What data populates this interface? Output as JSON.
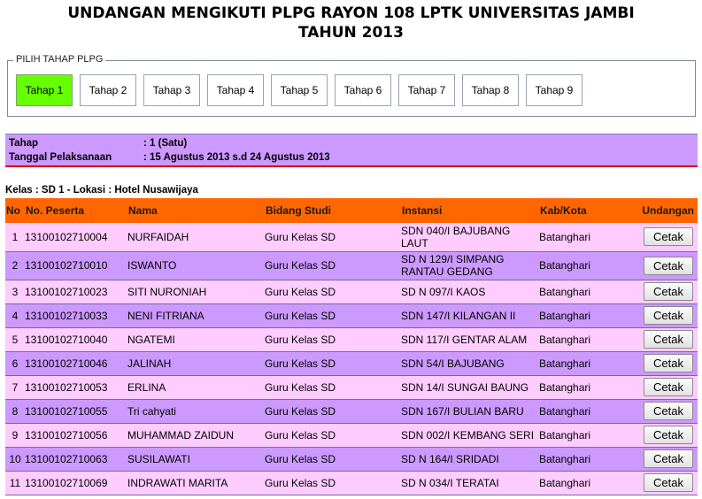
{
  "page": {
    "title_line1": "UNDANGAN MENGIKUTI PLPG RAYON 108 LPTK UNIVERSITAS JAMBI",
    "title_line2": "TAHUN 2013"
  },
  "tahap_selector": {
    "legend": "PILIH TAHAP PLPG",
    "tabs": [
      "Tahap 1",
      "Tahap 2",
      "Tahap 3",
      "Tahap 4",
      "Tahap 5",
      "Tahap 6",
      "Tahap 7",
      "Tahap 8",
      "Tahap 9"
    ],
    "active_tab": "Tahap 1",
    "active_color": "#66ff00"
  },
  "info": {
    "tahap_label": "Tahap",
    "tahap_value": ": 1 (Satu)",
    "tanggal_label": "Tanggal Pelaksanaan",
    "tanggal_value": ": 15 Agustus 2013 s.d 24 Agustus 2013",
    "background_color": "#cc99ff",
    "border_color": "#d40000"
  },
  "kelas": "Kelas : SD 1 - Lokasi : Hotel Nusawijaya",
  "table": {
    "header_color": "#ff6600",
    "odd_row_color": "#ffccff",
    "even_row_color": "#cc99ff",
    "columns": {
      "no": "No",
      "no_peserta": "No. Peserta",
      "nama": "Nama",
      "bidang_studi": "Bidang Studi",
      "instansi": "Instansi",
      "kab_kota": "Kab/Kota",
      "undangan": "Undangan"
    },
    "button_label": "Cetak",
    "rows": [
      {
        "no": "1",
        "peserta": "13100102710004",
        "nama": "NURFAIDAH",
        "bidang": "Guru Kelas SD",
        "instansi": "SDN 040/I BAJUBANG LAUT",
        "kab": "Batanghari"
      },
      {
        "no": "2",
        "peserta": "13100102710010",
        "nama": "ISWANTO",
        "bidang": "Guru Kelas SD",
        "instansi": "SD N 129/I SIMPANG RANTAU GEDANG",
        "kab": "Batanghari"
      },
      {
        "no": "3",
        "peserta": "13100102710023",
        "nama": "SITI NURONIAH",
        "bidang": "Guru Kelas SD",
        "instansi": "SD N 097/I KAOS",
        "kab": "Batanghari"
      },
      {
        "no": "4",
        "peserta": "13100102710033",
        "nama": "NENI FITRIANA",
        "bidang": "Guru Kelas SD",
        "instansi": "SDN 147/I KILANGAN II",
        "kab": "Batanghari"
      },
      {
        "no": "5",
        "peserta": "13100102710040",
        "nama": "NGATEMI",
        "bidang": "Guru Kelas SD",
        "instansi": "SDN 117/I GENTAR ALAM",
        "kab": "Batanghari"
      },
      {
        "no": "6",
        "peserta": "13100102710046",
        "nama": "JALINAH",
        "bidang": "Guru Kelas SD",
        "instansi": "SDN 54/I BAJUBANG",
        "kab": "Batanghari"
      },
      {
        "no": "7",
        "peserta": "13100102710053",
        "nama": "ERLINA",
        "bidang": "Guru Kelas SD",
        "instansi": "SDN 14/I SUNGAI BAUNG",
        "kab": "Batanghari"
      },
      {
        "no": "8",
        "peserta": "13100102710055",
        "nama": "Tri cahyati",
        "bidang": "Guru Kelas SD",
        "instansi": "SDN 167/I BULIAN BARU",
        "kab": "Batanghari"
      },
      {
        "no": "9",
        "peserta": "13100102710056",
        "nama": "MUHAMMAD ZAIDUN",
        "bidang": "Guru Kelas SD",
        "instansi": "SDN 002/I KEMBANG SERI",
        "kab": "Batanghari"
      },
      {
        "no": "10",
        "peserta": "13100102710063",
        "nama": "SUSILAWATI",
        "bidang": "Guru Kelas SD",
        "instansi": "SD N 164/I SRIDADI",
        "kab": "Batanghari"
      },
      {
        "no": "11",
        "peserta": "13100102710069",
        "nama": "INDRAWATI MARITA",
        "bidang": "Guru Kelas SD",
        "instansi": "SD N 034/I TERATAI",
        "kab": "Batanghari"
      }
    ]
  }
}
